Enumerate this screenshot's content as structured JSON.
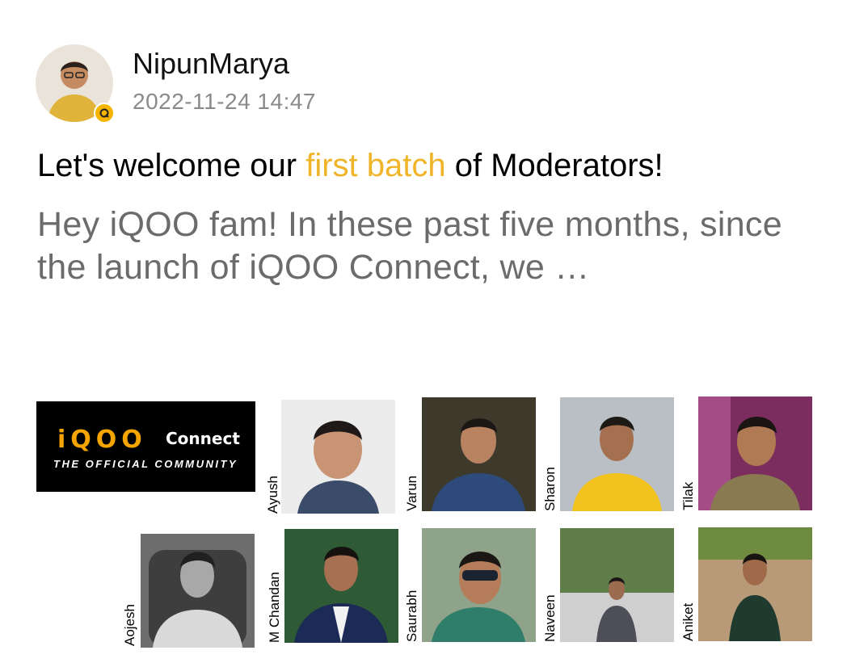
{
  "post": {
    "author": "NipunMarya",
    "timestamp": "2022-11-24 14:47",
    "title_before": "Let's welcome our ",
    "title_highlight": "first batch",
    "title_after": " of Moderators!",
    "excerpt": "Hey iQOO fam! In these past five months, since the launch of iQOO Connect, we …",
    "highlight_color": "#f0b429"
  },
  "image": {
    "logo": {
      "brand": "iQOO",
      "connect": "Connect",
      "tagline": "THE OFFICIAL COMMUNITY"
    },
    "moderators": [
      "Ayush",
      "Varun",
      "Sharon",
      "Tilak",
      "Aojesh",
      "M Chandan",
      "Saurabh",
      "Naveen",
      "Aniket"
    ]
  }
}
